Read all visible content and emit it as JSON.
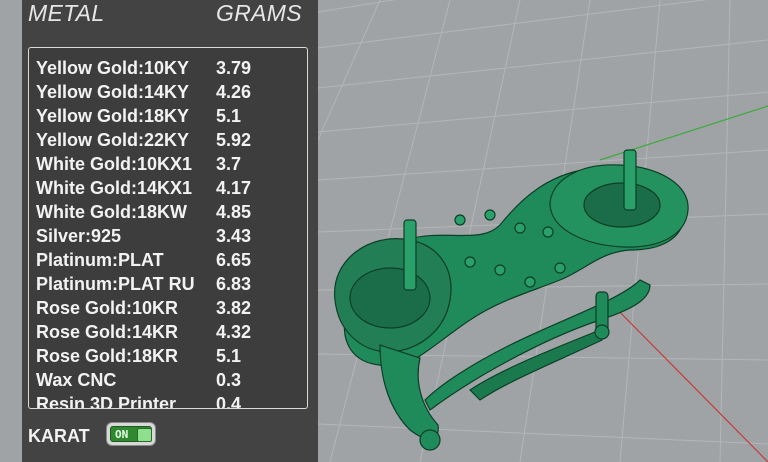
{
  "panel": {
    "header_metal": "METAL",
    "header_grams": "GRAMS",
    "rows": [
      {
        "metal": "Yellow Gold:10KY",
        "grams": "3.79"
      },
      {
        "metal": "Yellow Gold:14KY",
        "grams": "4.26"
      },
      {
        "metal": "Yellow Gold:18KY",
        "grams": "5.1"
      },
      {
        "metal": "Yellow Gold:22KY",
        "grams": "5.92"
      },
      {
        "metal": "White Gold:10KX1",
        "grams": "3.7"
      },
      {
        "metal": "White Gold:14KX1",
        "grams": "4.17"
      },
      {
        "metal": "White Gold:18KW",
        "grams": "4.85"
      },
      {
        "metal": "Silver:925",
        "grams": "3.43"
      },
      {
        "metal": "Platinum:PLAT",
        "grams": "6.65"
      },
      {
        "metal": "Platinum:PLAT RU",
        "grams": "6.83"
      },
      {
        "metal": "Rose Gold:10KR",
        "grams": "3.82"
      },
      {
        "metal": "Rose Gold:14KR",
        "grams": "4.32"
      },
      {
        "metal": "Rose Gold:18KR",
        "grams": "5.1"
      },
      {
        "metal": "Wax  CNC",
        "grams": "0.3"
      },
      {
        "metal": "Resin 3D Printer",
        "grams": "0.4"
      }
    ],
    "karat_label": "KARAT",
    "karat_toggle": {
      "text": "ON",
      "state": "on"
    }
  },
  "colors": {
    "viewport_bg": "#9fa3a6",
    "panel_bg": "#434343",
    "model": "#1f8a5a",
    "axis_x": "#c43a3a",
    "axis_y": "#3caa3c"
  }
}
